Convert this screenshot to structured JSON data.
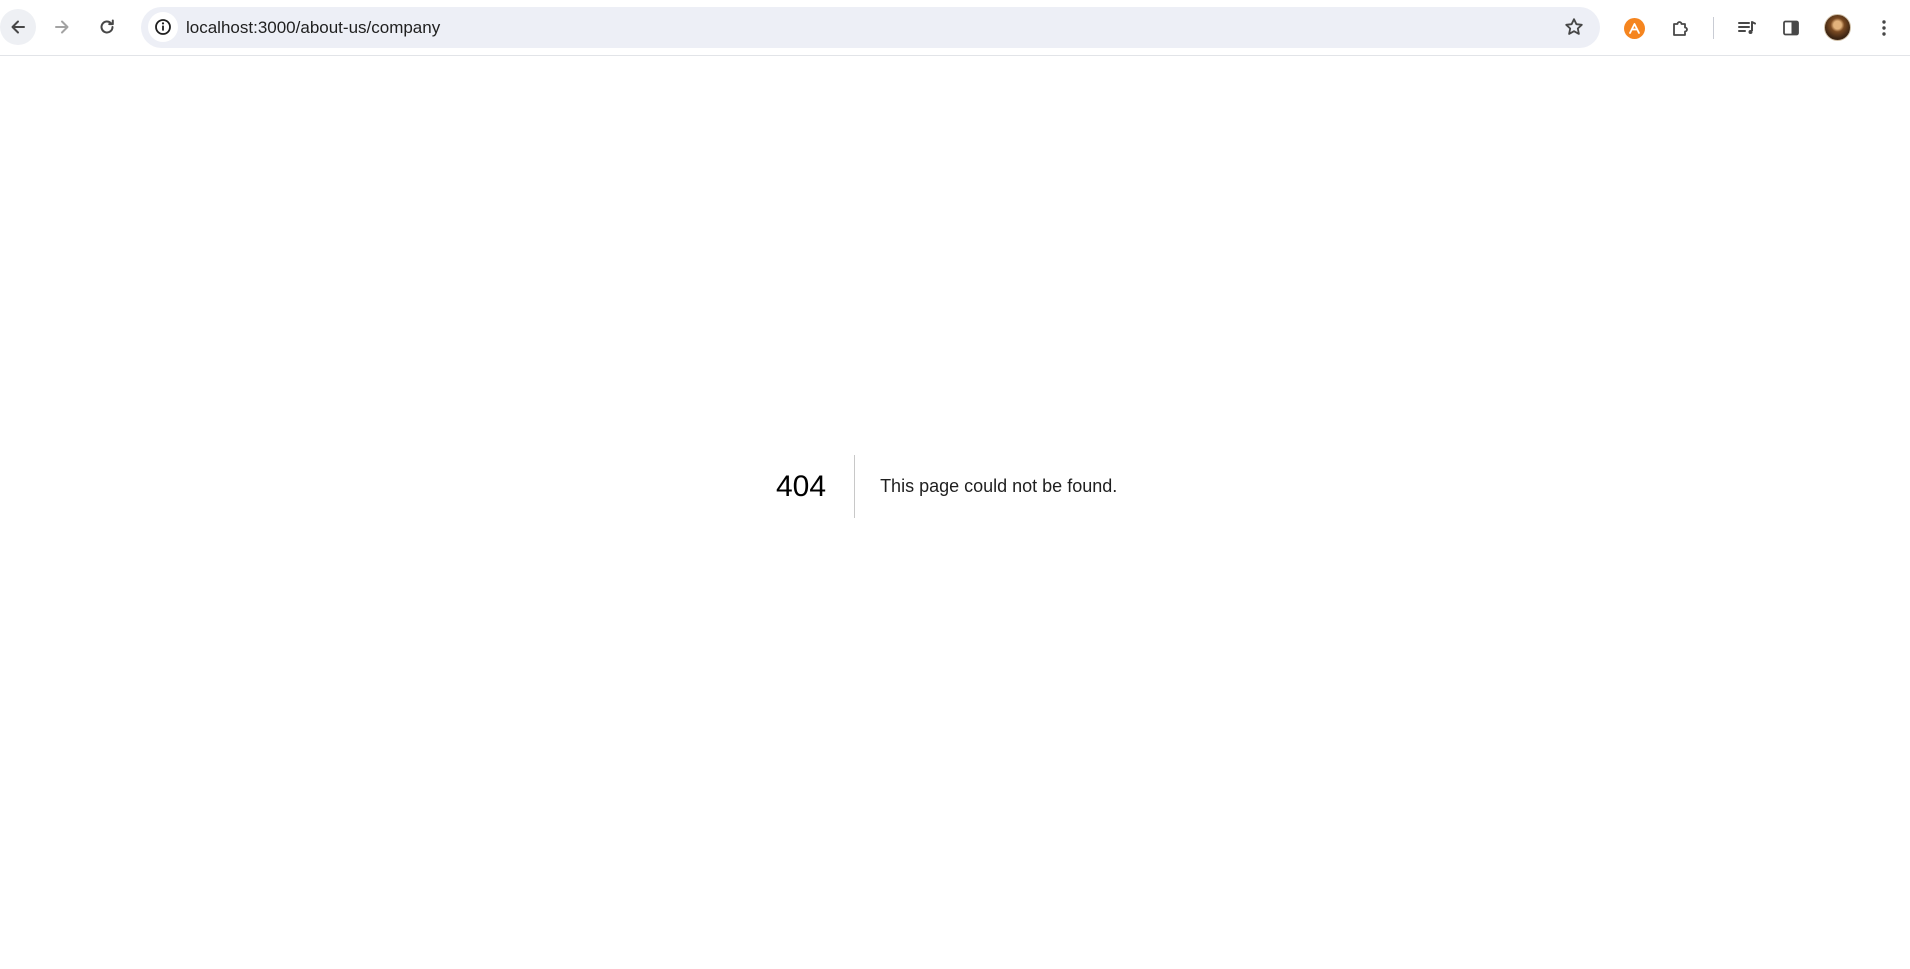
{
  "browser": {
    "url": "localhost:3000/about-us/company",
    "icons": {
      "back": "arrow-left-icon",
      "forward": "arrow-right-icon",
      "reload": "reload-icon",
      "site_info": "info-icon",
      "bookmark": "star-icon",
      "extension": "extension-badge-icon",
      "extensions_menu": "puzzle-icon",
      "media": "media-control-icon",
      "side_panel": "side-panel-icon",
      "profile": "avatar",
      "menu": "kebab-menu-icon"
    },
    "colors": {
      "toolbar_bg": "#ffffff",
      "omnibox_bg": "#edeff6",
      "extension_badge": "#f5851f"
    }
  },
  "error_page": {
    "code": "404",
    "message": "This page could not be found."
  }
}
